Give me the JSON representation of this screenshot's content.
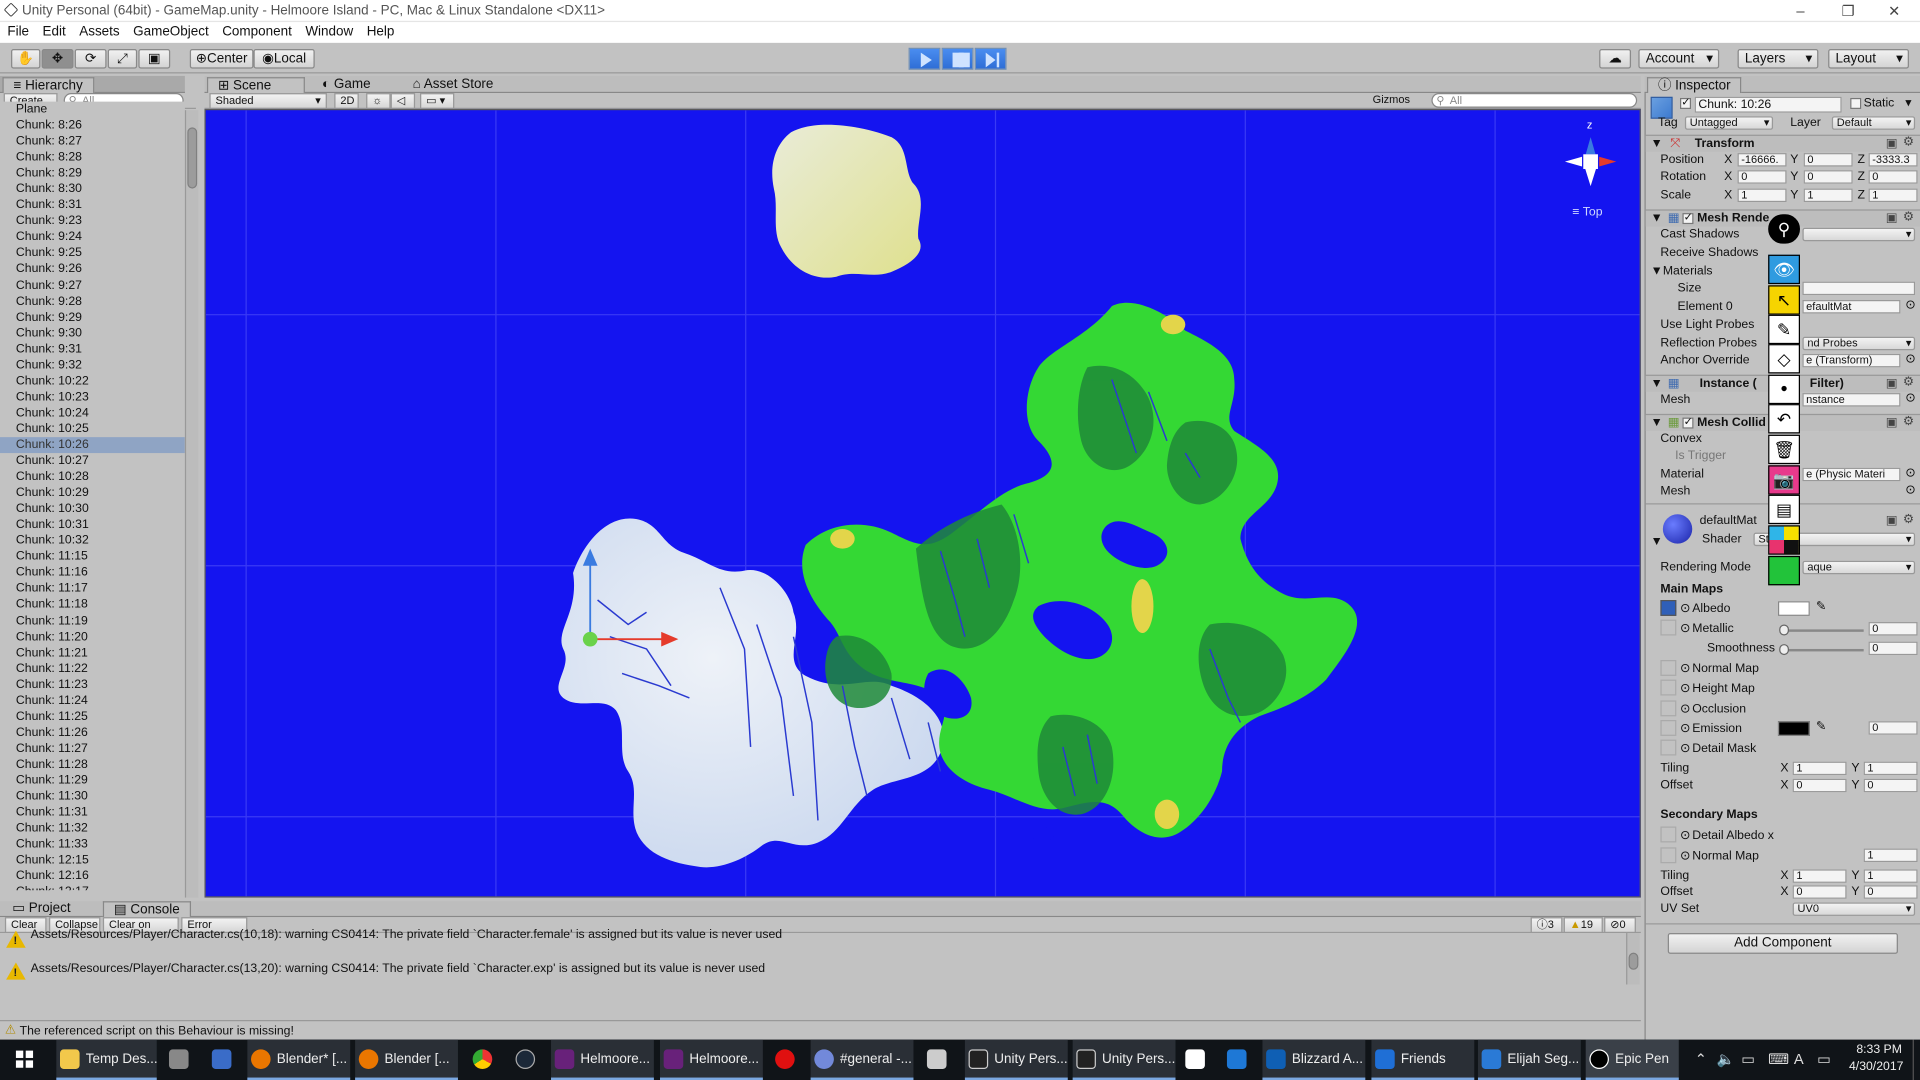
{
  "window": {
    "title": "Unity Personal (64bit) - GameMap.unity - Helmoore Island - PC, Mac & Linux Standalone <DX11>"
  },
  "menu": [
    "File",
    "Edit",
    "Assets",
    "GameObject",
    "Component",
    "Window",
    "Help"
  ],
  "toolbar": {
    "pivot": "Center",
    "space": "Local",
    "account": "Account",
    "layers": "Layers",
    "layout": "Layout"
  },
  "hierarchy": {
    "tab": "Hierarchy",
    "create": "Create",
    "search_placeholder": "All",
    "items": [
      "Plane",
      "Chunk: 8:26",
      "Chunk: 8:27",
      "Chunk: 8:28",
      "Chunk: 8:29",
      "Chunk: 8:30",
      "Chunk: 8:31",
      "Chunk: 9:23",
      "Chunk: 9:24",
      "Chunk: 9:25",
      "Chunk: 9:26",
      "Chunk: 9:27",
      "Chunk: 9:28",
      "Chunk: 9:29",
      "Chunk: 9:30",
      "Chunk: 9:31",
      "Chunk: 9:32",
      "Chunk: 10:22",
      "Chunk: 10:23",
      "Chunk: 10:24",
      "Chunk: 10:25",
      "Chunk: 10:26",
      "Chunk: 10:27",
      "Chunk: 10:28",
      "Chunk: 10:29",
      "Chunk: 10:30",
      "Chunk: 10:31",
      "Chunk: 10:32",
      "Chunk: 11:15",
      "Chunk: 11:16",
      "Chunk: 11:17",
      "Chunk: 11:18",
      "Chunk: 11:19",
      "Chunk: 11:20",
      "Chunk: 11:21",
      "Chunk: 11:22",
      "Chunk: 11:23",
      "Chunk: 11:24",
      "Chunk: 11:25",
      "Chunk: 11:26",
      "Chunk: 11:27",
      "Chunk: 11:28",
      "Chunk: 11:29",
      "Chunk: 11:30",
      "Chunk: 11:31",
      "Chunk: 11:32",
      "Chunk: 11:33",
      "Chunk: 12:15",
      "Chunk: 12:16",
      "Chunk: 12:17"
    ],
    "selected": "Chunk: 10:26"
  },
  "scene": {
    "tabs": [
      "Scene",
      "Game",
      "Asset Store"
    ],
    "shading": "Shaded",
    "mode2d": "2D",
    "gizmos": "Gizmos",
    "search_placeholder": "All",
    "gizmo_axis_label": "z",
    "view_label": "Top"
  },
  "console": {
    "tabs": [
      "Project",
      "Console"
    ],
    "buttons": [
      "Clear",
      "Collapse",
      "Clear on Play",
      "Error Pause"
    ],
    "counts": {
      "info": "3",
      "warn": "19",
      "error": "0"
    },
    "messages": [
      "Assets/Resources/Player/Character.cs(10,18): warning CS0414: The private field `Character.female' is assigned but its value is never used",
      "Assets/Resources/Player/Character.cs(13,20): warning CS0414: The private field `Character.exp' is assigned but its value is never used"
    ],
    "status": "The referenced script on this Behaviour is missing!"
  },
  "inspector": {
    "tab": "Inspector",
    "object_name": "Chunk: 10:26",
    "static_label": "Static",
    "tag_label": "Tag",
    "tag_value": "Untagged",
    "layer_label": "Layer",
    "layer_value": "Default",
    "transform": {
      "title": "Transform",
      "position": {
        "label": "Position",
        "x": "-16666.",
        "y": "0",
        "z": "-3333.3"
      },
      "rotation": {
        "label": "Rotation",
        "x": "0",
        "y": "0",
        "z": "0"
      },
      "scale": {
        "label": "Scale",
        "x": "1",
        "y": "1",
        "z": "1"
      }
    },
    "mesh_renderer": {
      "title": "Mesh Rende",
      "cast_shadows": "Cast Shadows",
      "receive_shadows": "Receive Shadows",
      "materials": "Materials",
      "size": "Size",
      "element0": "Element 0",
      "element0_value": "efaultMat",
      "light_probes": "Use Light Probes",
      "reflection_probes": "Reflection Probes",
      "reflection_value": "nd Probes",
      "anchor_override": "Anchor Override",
      "anchor_value": "e (Transform)"
    },
    "mesh_filter": {
      "title_a": "Instance (",
      "title_b": "Filter)",
      "mesh": "Mesh",
      "mesh_value": "nstance"
    },
    "mesh_collider": {
      "title": "Mesh Collid",
      "convex": "Convex",
      "is_trigger": "Is Trigger",
      "material": "Material",
      "material_value": "e (Physic Materi",
      "mesh": "Mesh"
    },
    "material": {
      "name": "defaultMat",
      "shader_label": "Shader",
      "shader_value": "St",
      "rendering_mode": "Rendering Mode",
      "rendering_value": "aque",
      "main_maps": "Main Maps",
      "albedo": "Albedo",
      "metallic": "Metallic",
      "metallic_value": "0",
      "smoothness": "Smoothness",
      "smoothness_value": "0",
      "normal_map": "Normal Map",
      "height_map": "Height Map",
      "occlusion": "Occlusion",
      "emission": "Emission",
      "emission_value": "0",
      "detail_mask": "Detail Mask",
      "tiling": "Tiling",
      "tiling_x": "1",
      "tiling_y": "1",
      "offset": "Offset",
      "offset_x": "0",
      "offset_y": "0",
      "secondary_maps": "Secondary Maps",
      "detail_albedo": "Detail Albedo x",
      "normal_map2": "Normal Map",
      "normal_map2_value": "1",
      "tiling2_x": "1",
      "tiling2_y": "1",
      "offset2_x": "0",
      "offset2_y": "0",
      "uv_set": "UV Set",
      "uv_value": "UV0"
    },
    "add_component": "Add Component"
  },
  "taskbar": {
    "items": [
      "Temp Des...",
      "",
      "",
      "Blender* [...",
      "Blender [...",
      "",
      "",
      "Helmoore...",
      "Helmoore...",
      "",
      "#general -...",
      "",
      "Unity Pers...",
      "Unity Pers...",
      "",
      "",
      "Blizzard A...",
      "Friends",
      "Elijah Seg...",
      "Epic Pen"
    ],
    "time": "8:33 PM",
    "date": "4/30/2017"
  },
  "colors": {
    "scene_bg": "#1414f0",
    "selection": "#8fa4c4",
    "play_blue": "#2f6ed6",
    "island_green": "#2ecc2e",
    "island_dark": "#1f7a32",
    "snow": "#d8e4f4",
    "sand": "#e6e29a"
  }
}
